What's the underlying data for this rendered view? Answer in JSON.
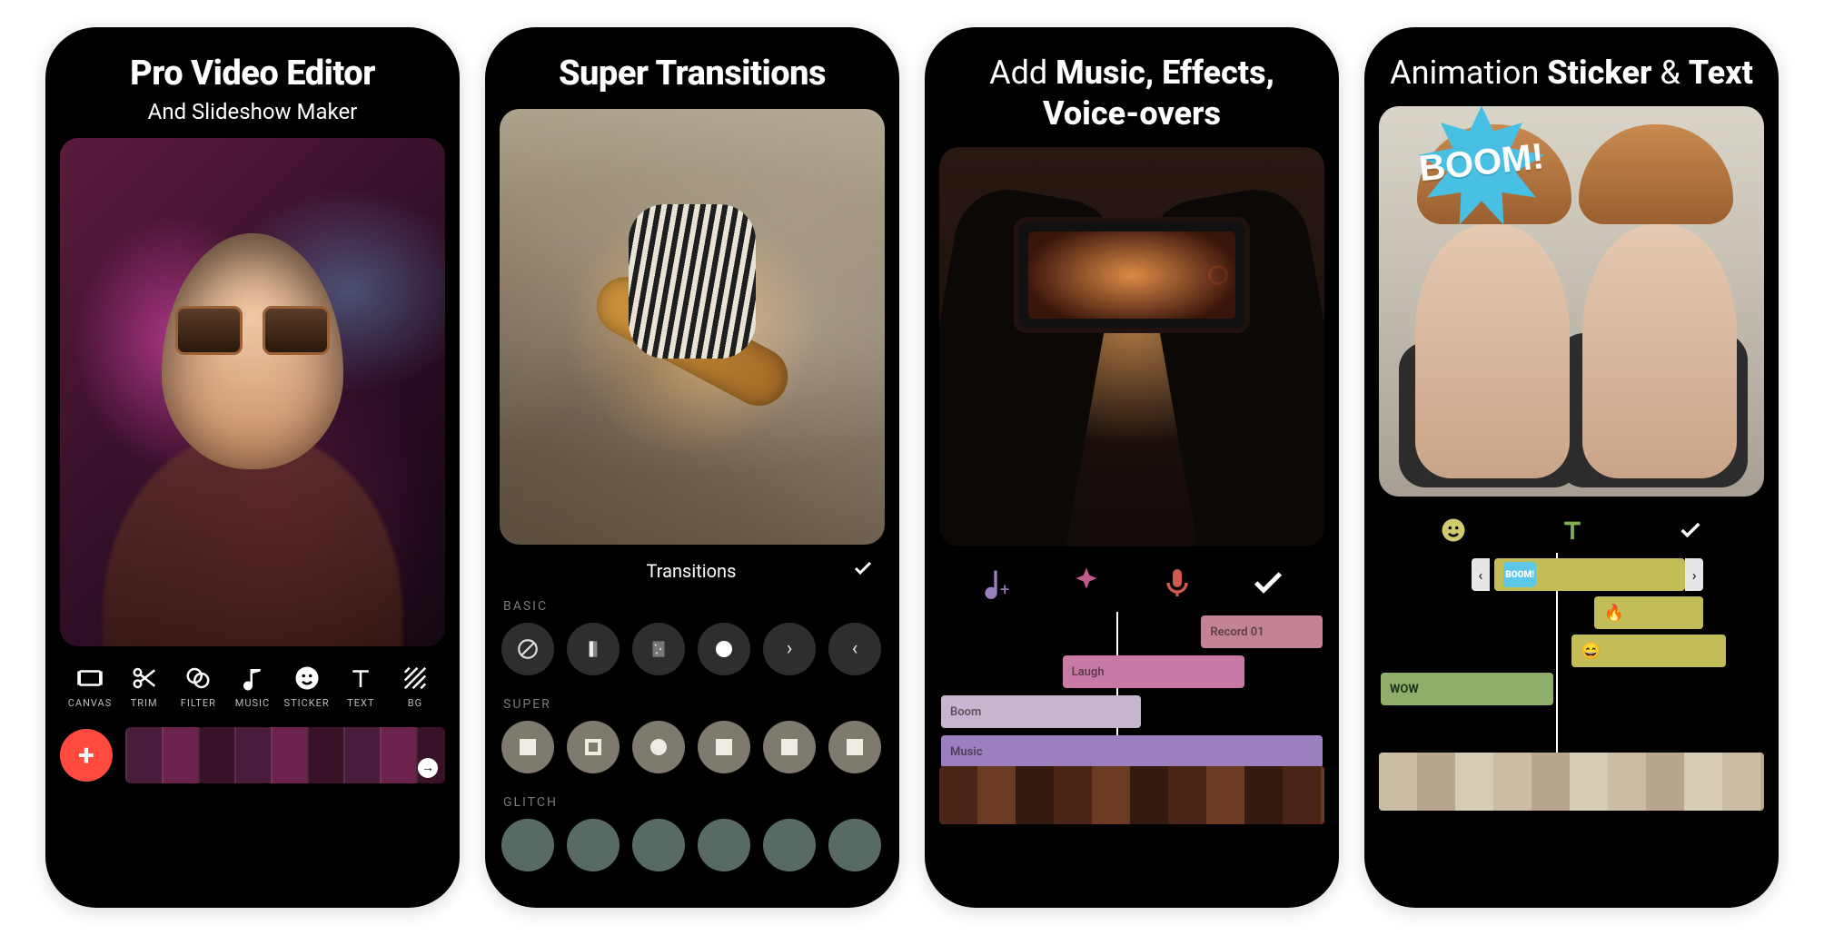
{
  "screens": [
    {
      "title_main": "Pro Video Editor",
      "title_sub": "And Slideshow Maker",
      "tools": [
        {
          "icon": "canvas-icon",
          "label": "CANVAS"
        },
        {
          "icon": "trim-icon",
          "label": "TRIM"
        },
        {
          "icon": "filter-icon",
          "label": "FILTER"
        },
        {
          "icon": "music-icon",
          "label": "MUSIC"
        },
        {
          "icon": "sticker-icon",
          "label": "STICKER"
        },
        {
          "icon": "text-icon",
          "label": "TEXT"
        },
        {
          "icon": "bg-icon",
          "label": "BG"
        }
      ],
      "add_button": "+"
    },
    {
      "title_line": "Super Transitions",
      "panel_title": "Transitions",
      "categories": [
        "BASIC",
        "SUPER",
        "GLITCH"
      ]
    },
    {
      "title_prefix": "Add ",
      "title_bold1": "Music, Effects,",
      "title_bold2": "Voice-overs",
      "icon_names": [
        "music-note-plus-icon",
        "sparkle-icon",
        "mic-icon",
        "check-icon"
      ],
      "tracks": {
        "record": "Record 01",
        "laugh": "Laugh",
        "boom": "Boom",
        "music": "Music"
      }
    },
    {
      "title_prefix": "Animation ",
      "title_bold1": "Sticker",
      "title_mid": " & ",
      "title_bold2": "Text",
      "sticker_text": "BOOM!",
      "icon_names": [
        "emoji-icon",
        "text-tool-icon",
        "check-icon"
      ],
      "chips": {
        "boom": "BOOM!",
        "fire": "🔥",
        "smile": "😄",
        "wow": "WOW"
      }
    }
  ]
}
